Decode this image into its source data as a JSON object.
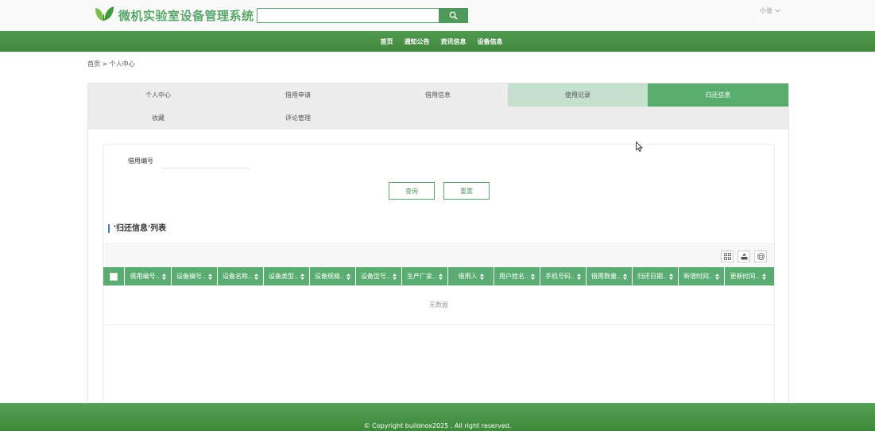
{
  "header": {
    "title": "微机实验室设备管理系统",
    "search_placeholder": "",
    "search_icon": "search-icon",
    "user_name": "小张",
    "brand_color": "#5aa66a"
  },
  "nav": [
    "首页",
    "通知公告",
    "资讯信息",
    "设备信息"
  ],
  "breadcrumb": "首页 > 个人中心",
  "tabs": [
    {
      "label": "个人中心"
    },
    {
      "label": "借用申请"
    },
    {
      "label": "借用信息"
    },
    {
      "label": "使用记录",
      "state": "hover"
    },
    {
      "label": "归还信息",
      "state": "active"
    },
    {
      "label": "收藏"
    },
    {
      "label": "评论管理"
    }
  ],
  "search_form": {
    "label": "借用编号",
    "value": "",
    "query_button": "查询",
    "reset_button": "重置"
  },
  "list": {
    "title": "'归还信息'列表",
    "tools": [
      "columns-icon",
      "export-icon",
      "print-icon"
    ],
    "columns": [
      "借用编号..",
      "设备编号..",
      "设备名称..",
      "设备类型..",
      "设备规格..",
      "设备型号..",
      "生产厂家..",
      "借用人",
      "用户姓名..",
      "手机号码..",
      "借用数量..",
      "归还日期..",
      "新增时间..",
      "更新时间.."
    ],
    "empty_text": "无数据"
  },
  "footer": {
    "copyright": "© Copyright buildnox2025 . All right reserved."
  },
  "colors": {
    "accent": "#5aa66a",
    "nav_bg": "#4a924a",
    "tab_active": "#57ac6e",
    "tab_hover": "#c5e0cc",
    "table_header": "#5aac72"
  }
}
